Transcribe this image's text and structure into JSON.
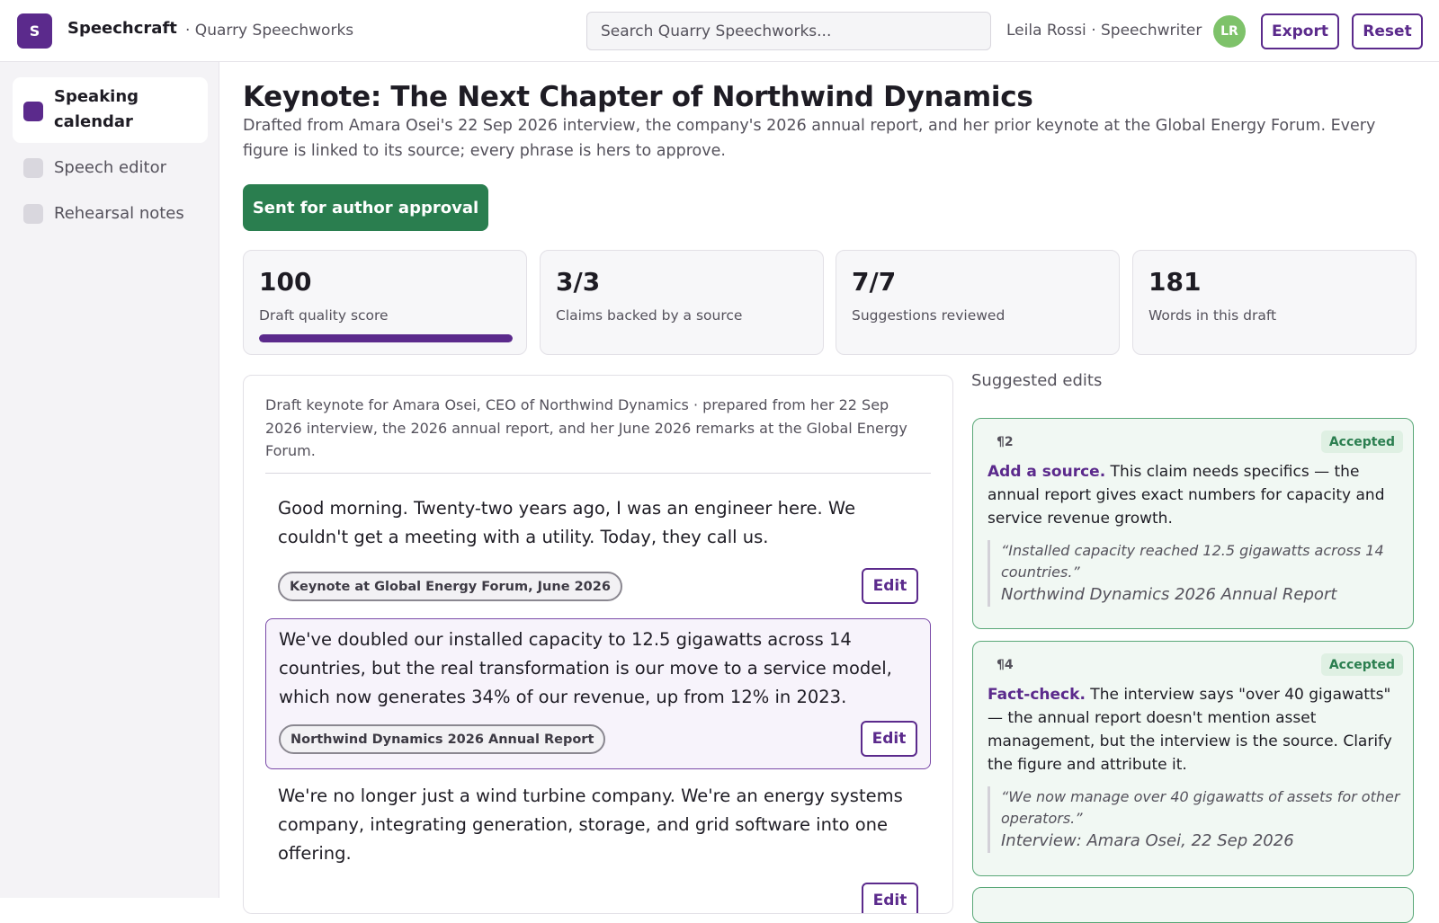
{
  "app": {
    "logo_letter": "S",
    "name": "Speechcraft",
    "org": "· Quarry Speechworks"
  },
  "header": {
    "search_placeholder": "Search Quarry Speechworks...",
    "user": "Leila Rossi · Speechwriter",
    "avatar_initials": "LR",
    "export_label": "Export",
    "reset_label": "Reset"
  },
  "sidebar": {
    "items": [
      {
        "label": "Speaking calendar",
        "active": true,
        "color": "#5b2a8c"
      },
      {
        "label": "Speech editor",
        "active": false,
        "color": "#d9d7de"
      },
      {
        "label": "Rehearsal notes",
        "active": false,
        "color": "#d9d7de"
      }
    ]
  },
  "page": {
    "title": "Keynote: The Next Chapter of Northwind Dynamics",
    "subtitle": "Drafted from Amara Osei's 22 Sep 2026 interview, the company's 2026 annual report, and her prior keynote at the Global Energy Forum. Every figure is linked to its source; every phrase is hers to approve.",
    "status_button": "Sent for author approval"
  },
  "stats": [
    {
      "value": "100",
      "caption": "Draft quality score",
      "progress": 1.0
    },
    {
      "value": "3/3",
      "caption": "Claims backed by a source"
    },
    {
      "value": "7/7",
      "caption": "Suggestions reviewed"
    },
    {
      "value": "181",
      "caption": "Words in this draft"
    }
  ],
  "draft": {
    "intro": "Draft keynote for Amara Osei, CEO of Northwind Dynamics · prepared from her 22 Sep 2026 interview, the 2026 annual report, and her June 2026 remarks at the Global Energy Forum.",
    "edit_label": "Edit",
    "paragraphs": [
      {
        "text": "Good morning. Twenty-two years ago, I was an engineer here. We couldn't get a meeting with a utility. Today, they call us.",
        "source": "Keynote at Global Energy Forum, June 2026"
      },
      {
        "text": "We've doubled our installed capacity to 12.5 gigawatts across 14 countries, but the real transformation is our move to a service model, which now generates 34% of our revenue, up from 12% in 2023.",
        "source": "Northwind Dynamics 2026 Annual Report"
      },
      {
        "text": "We're no longer just a wind turbine company. We're an energy systems company, integrating generation, storage, and grid software into one offering."
      }
    ]
  },
  "suggestions": {
    "heading": "Suggested edits",
    "items": [
      {
        "para": "¶2",
        "status": "Accepted",
        "action": "Add a source.",
        "body": " This claim needs specifics — the annual report gives exact numbers for capacity and service revenue growth.",
        "quote": "“Installed capacity reached 12.5 gigawatts across 14 countries.”",
        "source": "Northwind Dynamics 2026 Annual Report"
      },
      {
        "para": "¶4",
        "status": "Accepted",
        "action": "Fact-check.",
        "body": " The interview says \"over 40 gigawatts\" — the annual report doesn't mention asset management, but the interview is the source. Clarify the figure and attribute it.",
        "quote": "“We now manage over 40 gigawatts of assets for other operators.”",
        "source": "Interview: Amara Osei, 22 Sep 2026"
      }
    ]
  }
}
